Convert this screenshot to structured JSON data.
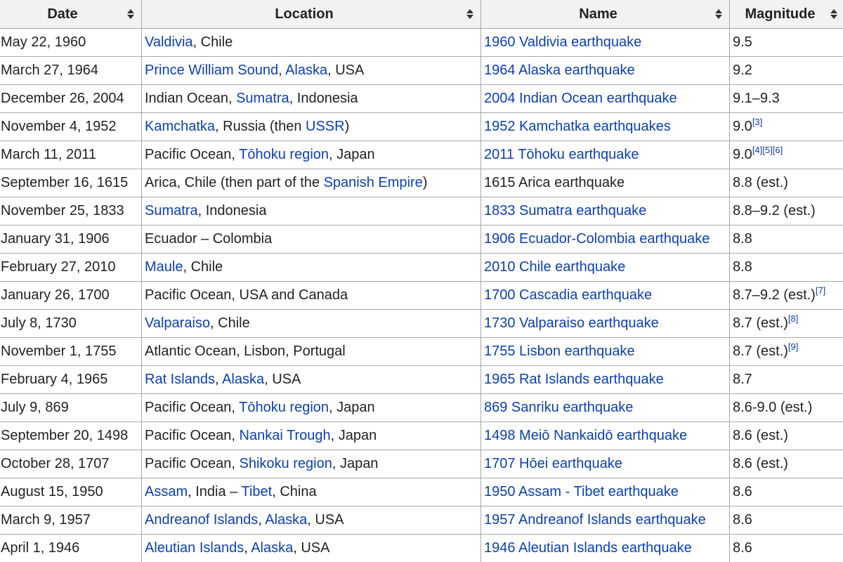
{
  "headers": {
    "date": "Date",
    "location": "Location",
    "name": "Name",
    "magnitude": "Magnitude"
  },
  "rows": [
    {
      "date": "May 22, 1960",
      "location": [
        {
          "t": "Valdivia",
          "link": true
        },
        {
          "t": ", Chile"
        }
      ],
      "name": {
        "t": "1960 Valdivia earthquake",
        "link": true
      },
      "magnitude": "9.5",
      "refs": []
    },
    {
      "date": "March 27, 1964",
      "location": [
        {
          "t": "Prince William Sound",
          "link": true
        },
        {
          "t": ", "
        },
        {
          "t": "Alaska",
          "link": true
        },
        {
          "t": ", USA"
        }
      ],
      "name": {
        "t": "1964 Alaska earthquake",
        "link": true
      },
      "magnitude": "9.2",
      "refs": []
    },
    {
      "date": "December 26, 2004",
      "location": [
        {
          "t": "Indian Ocean, "
        },
        {
          "t": "Sumatra",
          "link": true
        },
        {
          "t": ", Indonesia"
        }
      ],
      "name": {
        "t": "2004 Indian Ocean earthquake",
        "link": true
      },
      "magnitude": "9.1–9.3",
      "refs": []
    },
    {
      "date": "November 4, 1952",
      "location": [
        {
          "t": "Kamchatka",
          "link": true
        },
        {
          "t": ", Russia (then "
        },
        {
          "t": "USSR",
          "link": true
        },
        {
          "t": ")"
        }
      ],
      "name": {
        "t": "1952 Kamchatka earthquakes",
        "link": true
      },
      "magnitude": "9.0",
      "refs": [
        "[3]"
      ]
    },
    {
      "date": "March 11, 2011",
      "location": [
        {
          "t": "Pacific Ocean, "
        },
        {
          "t": "Tōhoku region",
          "link": true
        },
        {
          "t": ", Japan"
        }
      ],
      "name": {
        "t": "2011 Tōhoku earthquake",
        "link": true
      },
      "magnitude": "9.0",
      "refs": [
        "[4]",
        "[5]",
        "[6]"
      ]
    },
    {
      "date": "September 16, 1615",
      "location": [
        {
          "t": "Arica, Chile (then part of the "
        },
        {
          "t": "Spanish Empire",
          "link": true
        },
        {
          "t": ")"
        }
      ],
      "name": {
        "t": "1615 Arica earthquake",
        "link": false
      },
      "magnitude": "8.8 (est.)",
      "refs": []
    },
    {
      "date": "November 25, 1833",
      "location": [
        {
          "t": "Sumatra",
          "link": true
        },
        {
          "t": ", Indonesia"
        }
      ],
      "name": {
        "t": "1833 Sumatra earthquake",
        "link": true
      },
      "magnitude": "8.8–9.2 (est.)",
      "refs": []
    },
    {
      "date": "January 31, 1906",
      "location": [
        {
          "t": "Ecuador – Colombia"
        }
      ],
      "name": {
        "t": "1906 Ecuador-Colombia earthquake",
        "link": true
      },
      "magnitude": "8.8",
      "refs": []
    },
    {
      "date": "February 27, 2010",
      "location": [
        {
          "t": "Maule",
          "link": true
        },
        {
          "t": ", Chile"
        }
      ],
      "name": {
        "t": "2010 Chile earthquake",
        "link": true
      },
      "magnitude": "8.8",
      "refs": []
    },
    {
      "date": "January 26, 1700",
      "location": [
        {
          "t": "Pacific Ocean, USA and Canada"
        }
      ],
      "name": {
        "t": "1700 Cascadia earthquake",
        "link": true
      },
      "magnitude": "8.7–9.2 (est.)",
      "refs": [
        "[7]"
      ]
    },
    {
      "date": "July 8, 1730",
      "location": [
        {
          "t": "Valparaiso",
          "link": true
        },
        {
          "t": ", Chile"
        }
      ],
      "name": {
        "t": "1730 Valparaiso earthquake",
        "link": true
      },
      "magnitude": "8.7 (est.)",
      "refs": [
        "[8]"
      ]
    },
    {
      "date": "November 1, 1755",
      "location": [
        {
          "t": "Atlantic Ocean, Lisbon, Portugal"
        }
      ],
      "name": {
        "t": "1755 Lisbon earthquake",
        "link": true
      },
      "magnitude": "8.7 (est.)",
      "refs": [
        "[9]"
      ]
    },
    {
      "date": "February 4, 1965",
      "location": [
        {
          "t": "Rat Islands",
          "link": true
        },
        {
          "t": ", "
        },
        {
          "t": "Alaska",
          "link": true
        },
        {
          "t": ", USA"
        }
      ],
      "name": {
        "t": "1965 Rat Islands earthquake",
        "link": true
      },
      "magnitude": "8.7",
      "refs": []
    },
    {
      "date": "July 9, 869",
      "location": [
        {
          "t": "Pacific Ocean, "
        },
        {
          "t": "Tōhoku region",
          "link": true
        },
        {
          "t": ", Japan"
        }
      ],
      "name": {
        "t": "869 Sanriku earthquake",
        "link": true
      },
      "magnitude": "8.6-9.0 (est.)",
      "refs": []
    },
    {
      "date": "September 20, 1498",
      "location": [
        {
          "t": "Pacific Ocean, "
        },
        {
          "t": "Nankai Trough",
          "link": true
        },
        {
          "t": ", Japan"
        }
      ],
      "name": {
        "t": "1498 Meiō Nankaidō earthquake",
        "link": true
      },
      "magnitude": "8.6 (est.)",
      "refs": []
    },
    {
      "date": "October 28, 1707",
      "location": [
        {
          "t": "Pacific Ocean, "
        },
        {
          "t": "Shikoku region",
          "link": true
        },
        {
          "t": ", Japan"
        }
      ],
      "name": {
        "t": "1707 Hōei earthquake",
        "link": true
      },
      "magnitude": "8.6 (est.)",
      "refs": []
    },
    {
      "date": "August 15, 1950",
      "location": [
        {
          "t": "Assam",
          "link": true
        },
        {
          "t": ", India – "
        },
        {
          "t": "Tibet",
          "link": true
        },
        {
          "t": ", China"
        }
      ],
      "name": {
        "t": "1950 Assam - Tibet earthquake",
        "link": true
      },
      "magnitude": "8.6",
      "refs": []
    },
    {
      "date": "March 9, 1957",
      "location": [
        {
          "t": "Andreanof Islands",
          "link": true
        },
        {
          "t": ", "
        },
        {
          "t": "Alaska",
          "link": true
        },
        {
          "t": ", USA"
        }
      ],
      "name": {
        "t": "1957 Andreanof Islands earthquake",
        "link": true
      },
      "magnitude": "8.6",
      "refs": []
    },
    {
      "date": "April 1, 1946",
      "location": [
        {
          "t": "Aleutian Islands",
          "link": true
        },
        {
          "t": ", "
        },
        {
          "t": "Alaska",
          "link": true
        },
        {
          "t": ", USA"
        }
      ],
      "name": {
        "t": "1946 Aleutian Islands earthquake",
        "link": true
      },
      "magnitude": "8.6",
      "refs": []
    }
  ],
  "colors": {
    "link": "#0b3fb5",
    "text": "#222222",
    "header_bg": "#f2f2f2",
    "border": "#a8a8a8"
  },
  "icons": {
    "sort": "sort-arrows-icon"
  }
}
